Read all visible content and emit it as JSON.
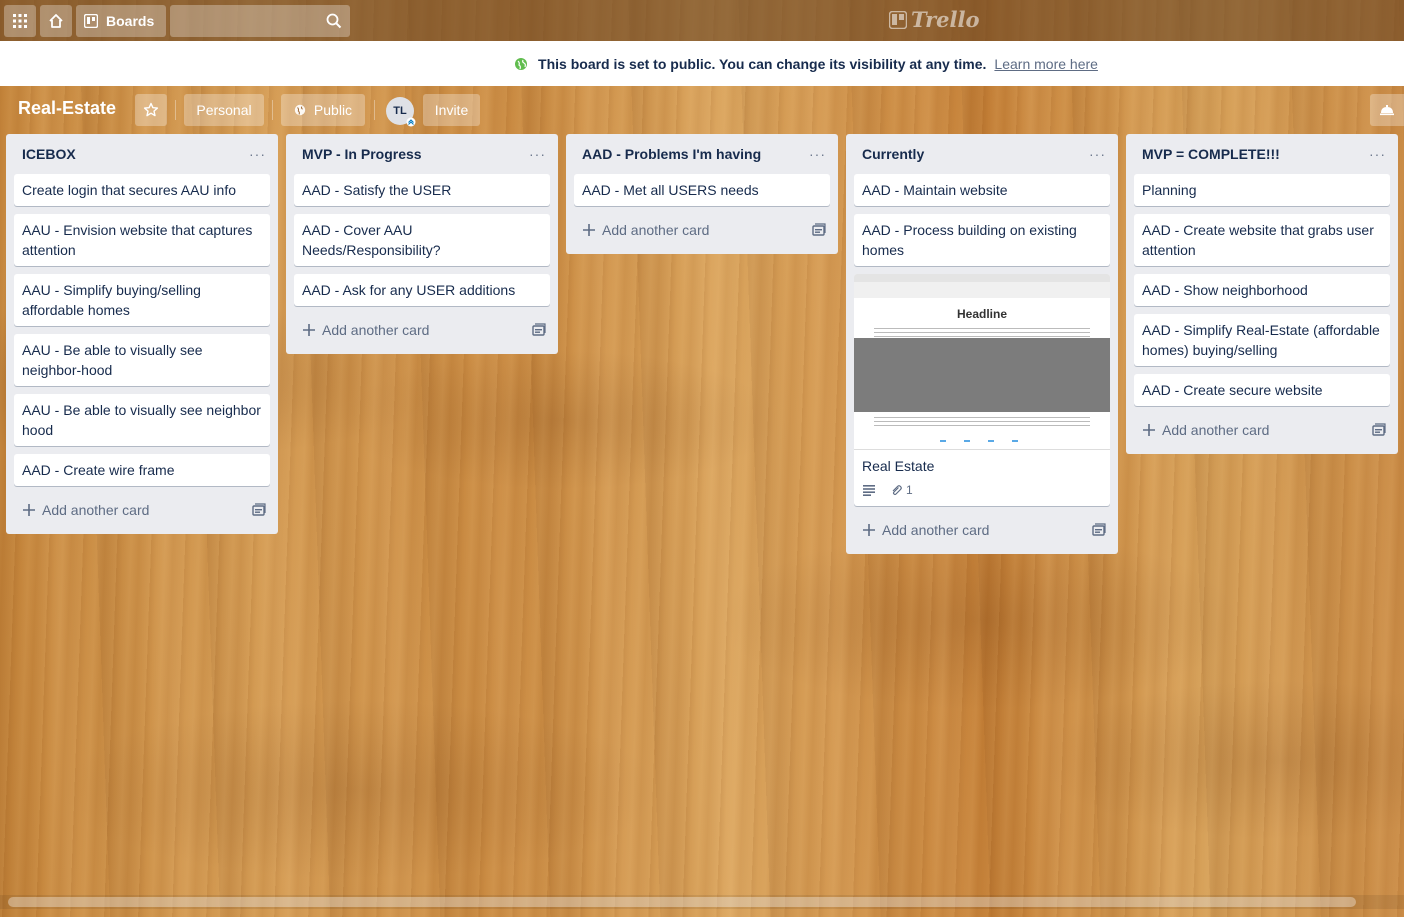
{
  "topbar": {
    "boards_label": "Boards",
    "search_value": "",
    "logo_text": "Trello"
  },
  "banner": {
    "message": "This board is set to public. You can change its visibility at any time.",
    "link": "Learn more here"
  },
  "board": {
    "title": "Real-Estate",
    "team_label": "Personal",
    "visibility_label": "Public",
    "member_initials": "TL",
    "invite_label": "Invite"
  },
  "lists": [
    {
      "title": "ICEBOX",
      "cards": [
        "Create login that secures AAU info",
        "AAU - Envision website that captures attention",
        "AAU - Simplify buying/selling affordable homes",
        "AAU - Be able to visually see neighbor-hood",
        "AAU - Be able to visually see neighbor hood",
        "AAD - Create wire frame"
      ]
    },
    {
      "title": "MVP - In Progress",
      "cards": [
        "AAD - Satisfy the USER",
        "AAD - Cover AAU Needs/Responsibility?",
        "AAD - Ask for any USER additions"
      ]
    },
    {
      "title": "AAD - Problems I'm having",
      "cards": [
        "AAD - Met all USERS needs"
      ]
    },
    {
      "title": "Currently",
      "cards": [
        "AAD - Maintain website",
        "AAD - Process building on existing homes"
      ],
      "image_card": {
        "cover_headline": "Headline",
        "title": "Real Estate",
        "attachments": "1"
      }
    },
    {
      "title": "MVP = COMPLETE!!!",
      "cards": [
        "Planning",
        "AAD - Create website that grabs user attention",
        "AAD - Show neighborhood",
        "AAD - Simplify Real-Estate (affordable homes) buying/selling",
        "AAD - Create secure website"
      ]
    }
  ],
  "add_card_label": "Add another card",
  "list_menu_glyph": "···",
  "colors": {
    "header_bg": "#6b4623",
    "list_bg": "#ebecf0",
    "text": "#172b4d",
    "public_green": "#61bd4f"
  },
  "icons": [
    "apps-icon",
    "home-icon",
    "boards-icon",
    "search-icon",
    "globe-icon",
    "star-icon",
    "plus-icon",
    "template-icon",
    "description-icon",
    "attachment-icon",
    "show-menu-icon"
  ]
}
